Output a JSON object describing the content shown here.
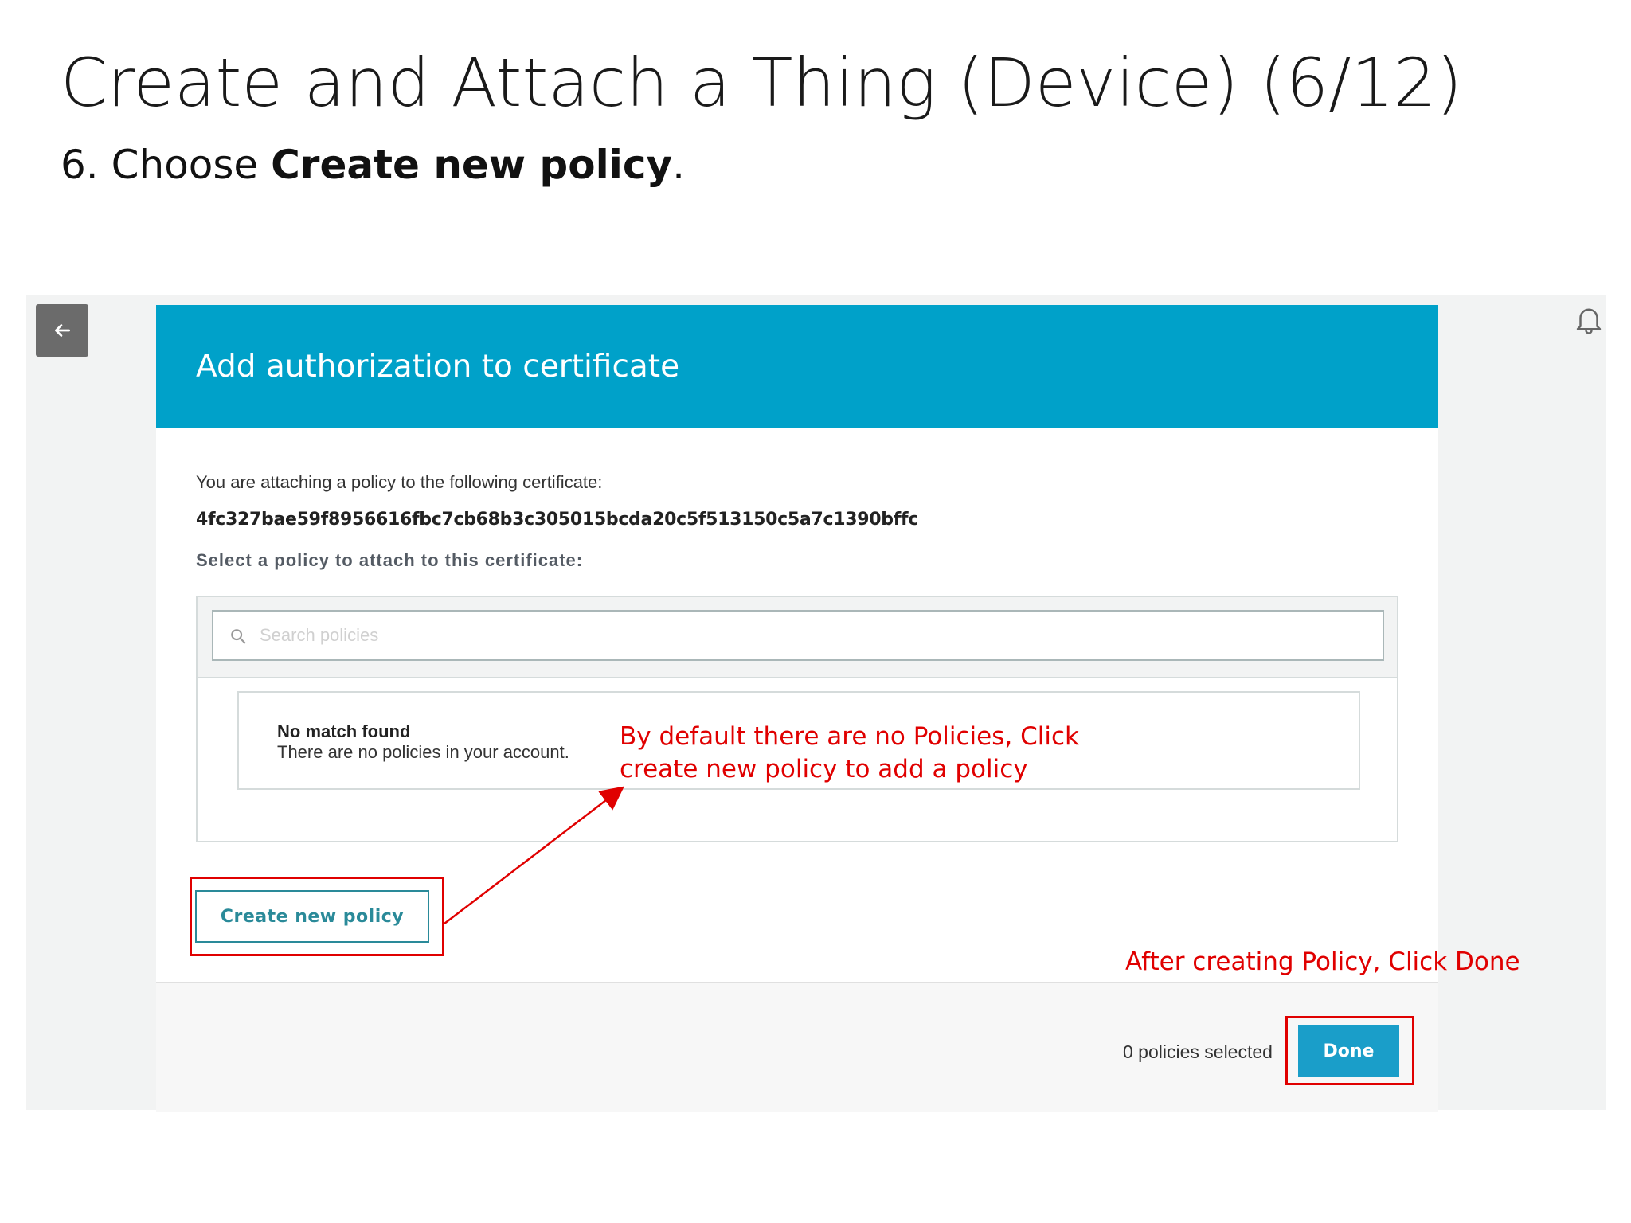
{
  "slide": {
    "title": "Create and Attach a Thing (Device) (6/12)",
    "subtitle_prefix": "6. Choose ",
    "subtitle_bold": "Create new policy",
    "subtitle_suffix": "."
  },
  "modal": {
    "title": "Add authorization to certificate",
    "intro": "You are attaching a policy to the following certificate:",
    "certificate_id": "4fc327bae59f8956616fbc7cb68b3c305015bcda20c5f513150c5a7c1390bffc",
    "select_label": "Select a policy to attach to this certificate:",
    "search_placeholder": "Search policies",
    "no_match_title": "No match found",
    "no_match_desc": "There are no policies in your account.",
    "create_button": "Create new policy",
    "selected_count": "0 policies selected",
    "done_button": "Done"
  },
  "annotations": {
    "note_1": "By default there are no Policies, Click\ncreate new policy to add a policy",
    "note_2": "After creating Policy, Click Done"
  },
  "colors": {
    "header": "#00a1c9",
    "annotation": "#e00000",
    "primary_button": "#1a9ec9"
  },
  "icons": {
    "back": "arrow-left-icon",
    "notifications": "bell-icon",
    "search": "search-icon"
  }
}
